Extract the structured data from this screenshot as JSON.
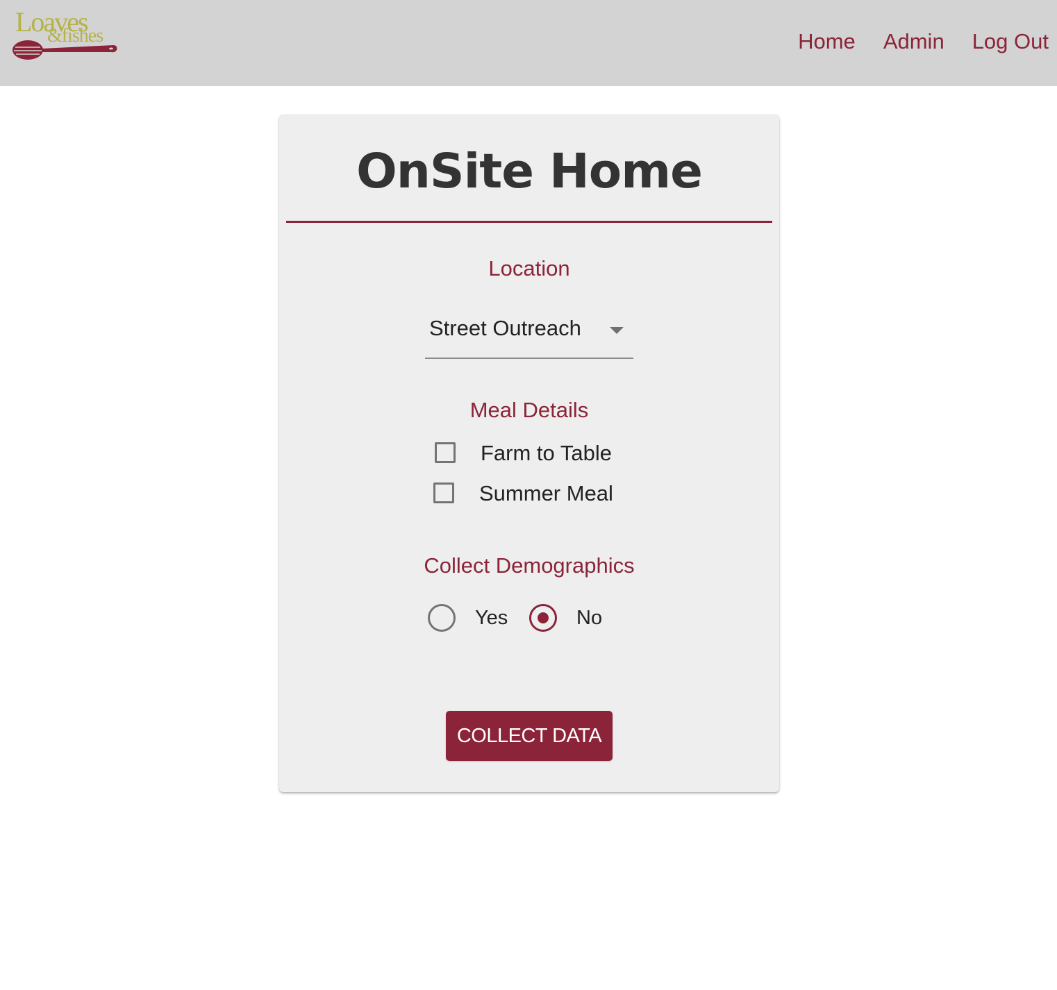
{
  "header": {
    "logo": {
      "text_top": "Loaves",
      "text_bottom": "&fishes"
    },
    "nav": [
      {
        "label": "Home"
      },
      {
        "label": "Admin"
      },
      {
        "label": "Log Out"
      }
    ]
  },
  "card": {
    "title": "OnSite Home",
    "location": {
      "label": "Location",
      "selected": "Street Outreach"
    },
    "meal_details": {
      "label": "Meal Details",
      "options": [
        {
          "label": "Farm to Table",
          "checked": false
        },
        {
          "label": "Summer Meal",
          "checked": false
        }
      ]
    },
    "demographics": {
      "label": "Collect Demographics",
      "options": [
        {
          "label": "Yes",
          "selected": false
        },
        {
          "label": "No",
          "selected": true
        }
      ]
    },
    "submit_label": "COLLECT DATA"
  },
  "colors": {
    "brand": "#8b2439",
    "logo_olive": "#b5b347",
    "topbar": "#d3d3d3",
    "card": "#eeeeee"
  }
}
